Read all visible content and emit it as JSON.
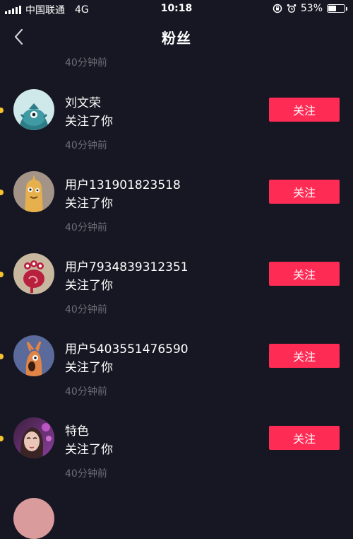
{
  "status_bar": {
    "carrier": "中国联通",
    "network": "4G",
    "time": "10:18",
    "battery_percent": "53%",
    "battery_level": 0.53
  },
  "nav": {
    "title": "粉丝",
    "back_icon": "chevron-left-icon"
  },
  "list": {
    "top_time": "40分钟前",
    "items": [
      {
        "name": "刘文荣",
        "action": "关注了你",
        "time": "40分钟前",
        "button": "关注",
        "avatar": "teal-monster-avatar"
      },
      {
        "name": "用户131901823518",
        "action": "关注了你",
        "time": "40分钟前",
        "button": "关注",
        "avatar": "yellow-creature-avatar"
      },
      {
        "name": "用户7934839312351",
        "action": "关注了你",
        "time": "40分钟前",
        "button": "关注",
        "avatar": "red-monster-avatar"
      },
      {
        "name": "用户5403551476590",
        "action": "关注了你",
        "time": "40分钟前",
        "button": "关注",
        "avatar": "orange-bird-avatar"
      },
      {
        "name": "特色",
        "action": "关注了你",
        "time": "40分钟前",
        "button": "关注",
        "avatar": "photo-avatar"
      }
    ]
  },
  "colors": {
    "background": "#161722",
    "accent": "#fe2c55",
    "unread_dot": "#f5c32e",
    "secondary_text": "#6d6e78"
  }
}
